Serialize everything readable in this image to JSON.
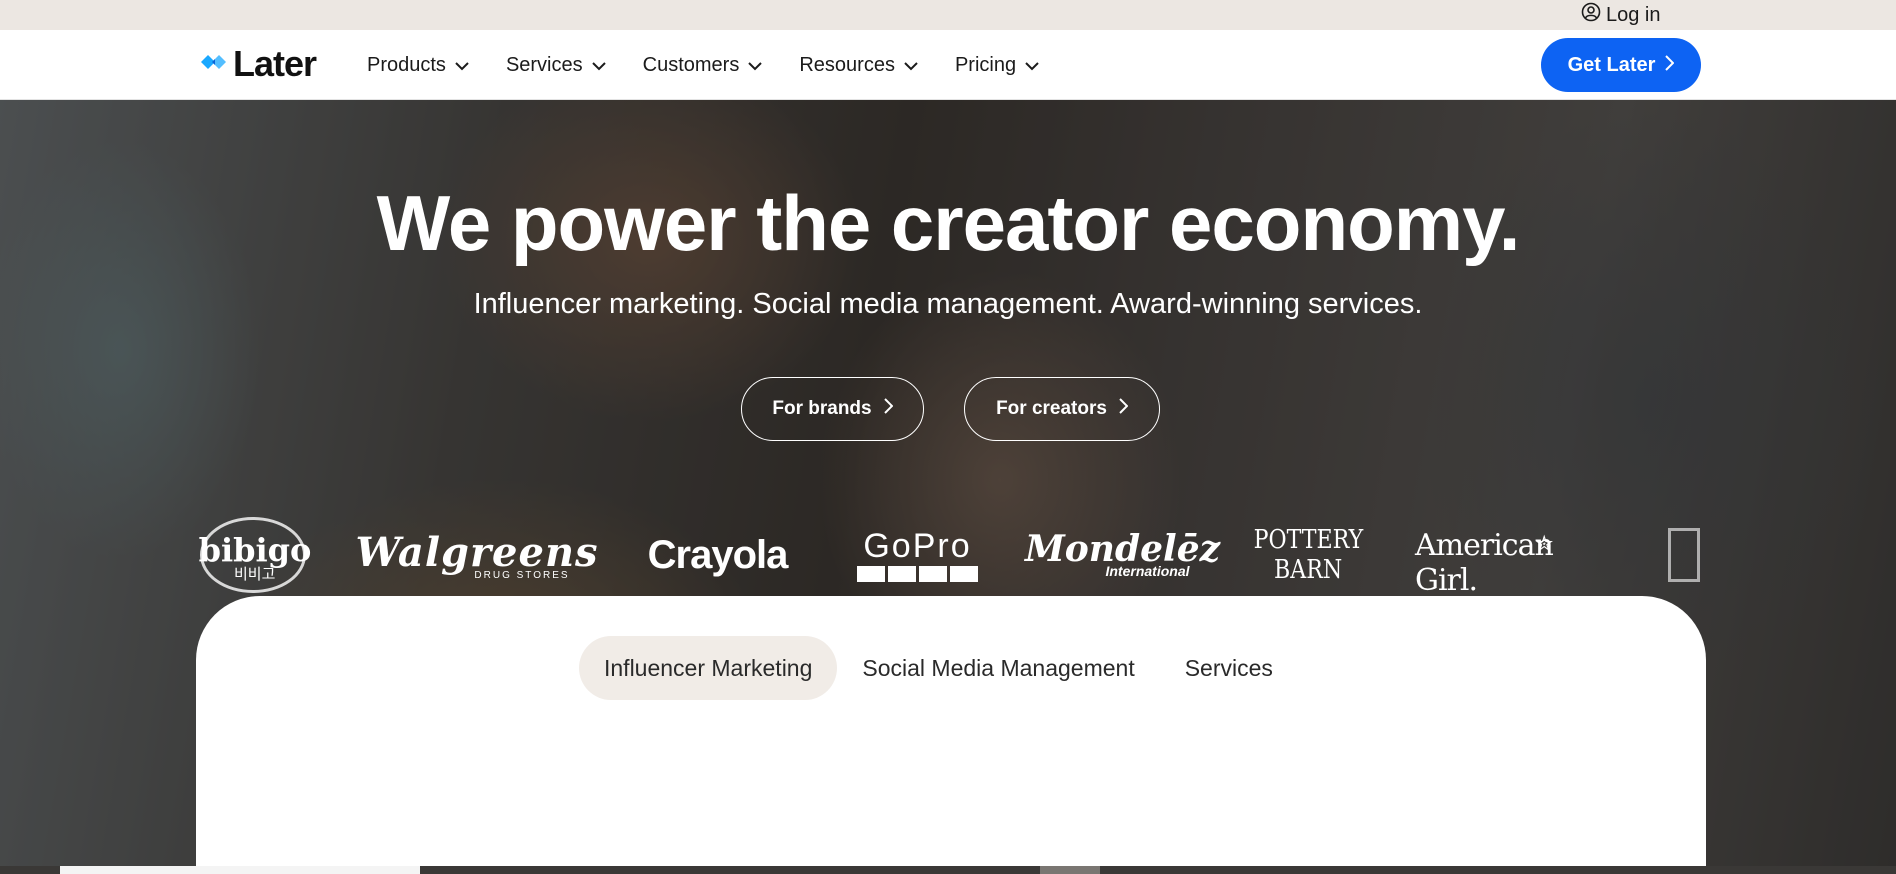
{
  "topbar": {
    "login_label": "Log in"
  },
  "nav": {
    "logo_text": "Later",
    "items": [
      {
        "label": "Products"
      },
      {
        "label": "Services"
      },
      {
        "label": "Customers"
      },
      {
        "label": "Resources"
      },
      {
        "label": "Pricing"
      }
    ],
    "cta_label": "Get Later"
  },
  "hero": {
    "headline": "We power the creator economy.",
    "subhead": "Influencer marketing. Social media management. Award-winning services.",
    "buttons": [
      {
        "label": "For brands"
      },
      {
        "label": "For creators"
      }
    ]
  },
  "brands": {
    "bibigo": {
      "name": "bibigo",
      "sub": "비비고"
    },
    "walgreens": {
      "name": "Walgreens",
      "sub": "DRUG STORES"
    },
    "crayola": {
      "name": "Crayola"
    },
    "gopro": {
      "name": "GoPro"
    },
    "mondelez": {
      "name": "Mondelēz",
      "sub": "International"
    },
    "pottery": {
      "line1": "POTTERY",
      "line2": "BARN"
    },
    "american": {
      "name": "American Girl."
    }
  },
  "card": {
    "tabs": [
      {
        "label": "Influencer Marketing",
        "active": true
      },
      {
        "label": "Social Media Management",
        "active": false
      },
      {
        "label": "Services",
        "active": false
      }
    ]
  },
  "colors": {
    "accent": "#0d63f3",
    "topbar_bg": "#ece7e2",
    "active_tab_bg": "#f1ece7",
    "logo_mark": "#1aa8ff"
  }
}
